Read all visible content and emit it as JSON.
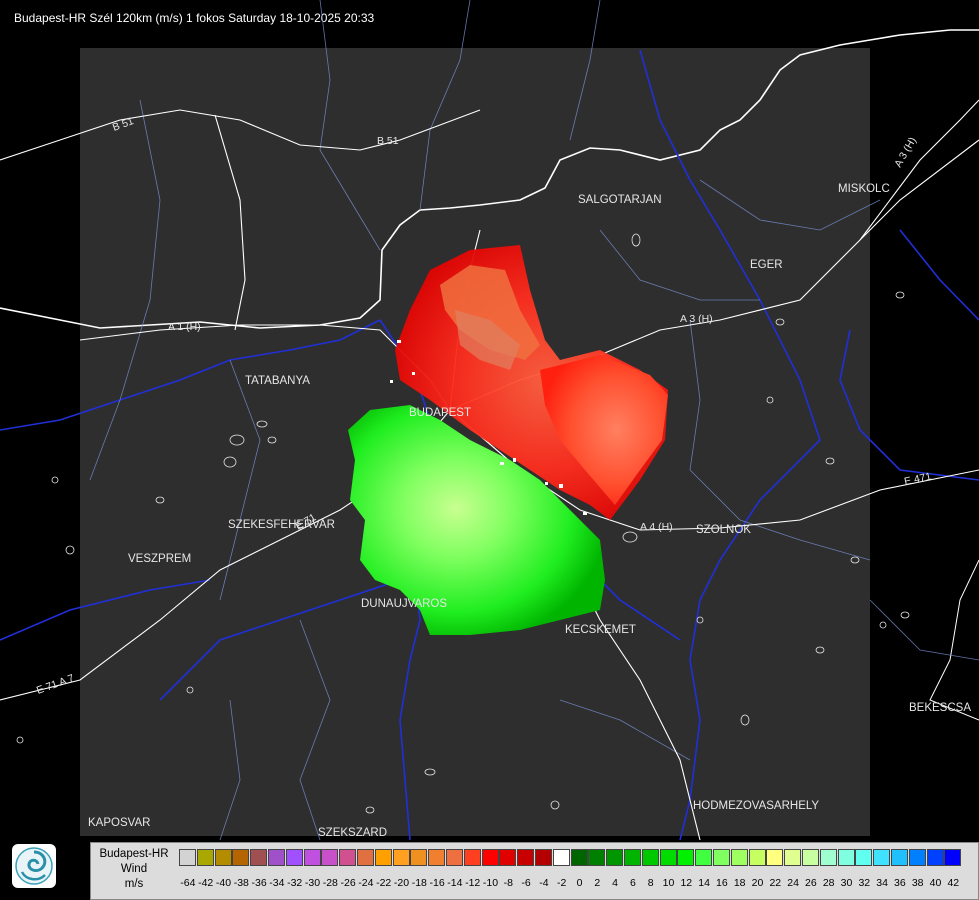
{
  "title": "Budapest-HR Szél 120km (m/s) 1 fokos Saturday 18-10-2025 20:33",
  "places": {
    "salgotarjan": "SALGOTARJAN",
    "miskolc": "MISKOLC",
    "eger": "EGER",
    "tatabanya": "TATABANYA",
    "budapest": "BUDAPEST",
    "szekesfehervar": "SZEKESFEHERVAR",
    "veszprem": "VESZPREM",
    "dunaujvaros": "DUNAUJVAROS",
    "kecskemet": "KECSKEMET",
    "szolnok": "SZOLNOK",
    "bekescsaba": "BEKESCSA",
    "hodmezovasarhely": "HODMEZOVASARHELY",
    "kaposvar": "KAPOSVAR",
    "szekszard": "SZEKSZARD"
  },
  "roads": {
    "b51_west": "B 51",
    "b51_north": "B 51",
    "a3_east": "A 3 (H)",
    "a3_mid": "A 3 (H)",
    "a1": "A 1 (H)",
    "a4": "A 4 (H)",
    "e71": "E 71",
    "e71_south": "E 71 A 7",
    "e471": "E 471"
  },
  "legend": {
    "name": "Budapest-HR",
    "quantity": "Wind",
    "unit": "m/s",
    "ticks": [
      "-64",
      "-42",
      "-40",
      "-38",
      "-36",
      "-34",
      "-32",
      "-30",
      "-28",
      "-26",
      "-24",
      "-22",
      "-20",
      "-18",
      "-16",
      "-14",
      "-12",
      "-10",
      "-8",
      "-6",
      "-4",
      "-2",
      "0",
      "2",
      "4",
      "6",
      "8",
      "10",
      "12",
      "14",
      "16",
      "18",
      "20",
      "22",
      "24",
      "26",
      "28",
      "30",
      "32",
      "34",
      "36",
      "38",
      "40",
      "42"
    ],
    "colors": [
      "#d3d3d3",
      "#a8a800",
      "#b48c00",
      "#b46400",
      "#a05050",
      "#a050c8",
      "#a050ff",
      "#c050e0",
      "#c850c8",
      "#d05090",
      "#e07040",
      "#ffa000",
      "#ffa020",
      "#f09020",
      "#f08030",
      "#ee7040",
      "#ff4020",
      "#ff0000",
      "#e00000",
      "#c80000",
      "#b40000",
      "#ffffff",
      "#006400",
      "#008000",
      "#009600",
      "#00b400",
      "#00c800",
      "#00dc00",
      "#00f000",
      "#40ff40",
      "#80ff60",
      "#a0ff60",
      "#c8ff60",
      "#ffff80",
      "#e0ff90",
      "#c8ffa0",
      "#a0ffd0",
      "#80ffe0",
      "#60fff0",
      "#40e0ff",
      "#20c0ff",
      "#0080ff",
      "#0040ff",
      "#0000ff"
    ]
  },
  "colors": {
    "background": "#000000",
    "radar_area": "#2e2e2e",
    "rivers": "#1f2fd0",
    "borders": "#ffffff",
    "roads": "#ffffff",
    "county_lines": "#7a8fd0",
    "approaching": "#00ff00",
    "receding": "#ff2020"
  }
}
